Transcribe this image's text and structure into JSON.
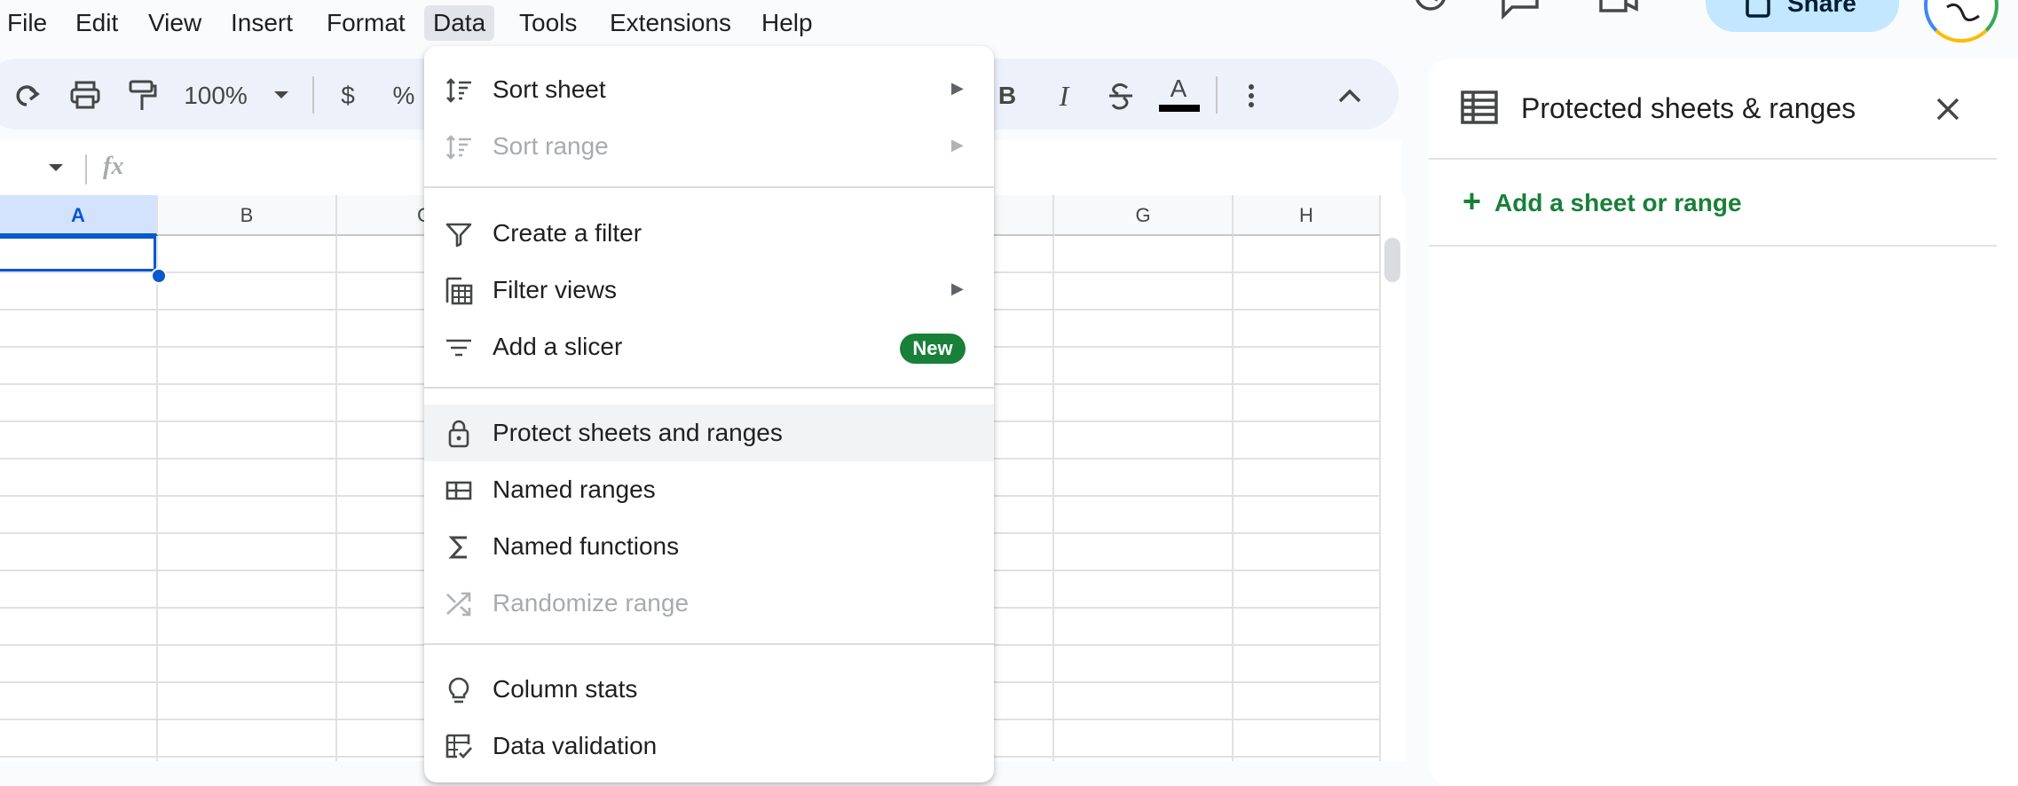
{
  "menubar": [
    "File",
    "Edit",
    "View",
    "Insert",
    "Format",
    "Data",
    "Tools",
    "Extensions",
    "Help"
  ],
  "share": {
    "label": "Share"
  },
  "toolbar": {
    "zoom": "100%",
    "currency": "$",
    "percent": "%",
    "bold": "B",
    "italic": "I",
    "text_color": "A"
  },
  "formula": {
    "fx": "fx"
  },
  "grid": {
    "columns": [
      "A",
      "B",
      "C",
      "G",
      "H"
    ]
  },
  "data_menu": {
    "items": [
      {
        "label": "Sort sheet",
        "icon": "sort-icon",
        "submenu": true
      },
      {
        "label": "Sort range",
        "icon": "sort-icon",
        "submenu": true,
        "disabled": true
      },
      {
        "label": "Create a filter",
        "icon": "filter-icon"
      },
      {
        "label": "Filter views",
        "icon": "filter-views-icon",
        "submenu": true
      },
      {
        "label": "Add a slicer",
        "icon": "slicer-icon",
        "badge": "New"
      },
      {
        "label": "Protect sheets and ranges",
        "icon": "lock-icon",
        "highlighted": true
      },
      {
        "label": "Named ranges",
        "icon": "named-ranges-icon"
      },
      {
        "label": "Named functions",
        "icon": "sigma-icon"
      },
      {
        "label": "Randomize range",
        "icon": "shuffle-icon",
        "disabled": true
      },
      {
        "label": "Column stats",
        "icon": "lightbulb-icon"
      },
      {
        "label": "Data validation",
        "icon": "data-validation-icon"
      }
    ]
  },
  "panel": {
    "title": "Protected sheets & ranges",
    "add_label": "Add a sheet or range"
  },
  "colors": {
    "accent": "#0b57d0",
    "green": "#188038",
    "share_bg": "#c2e7ff"
  }
}
